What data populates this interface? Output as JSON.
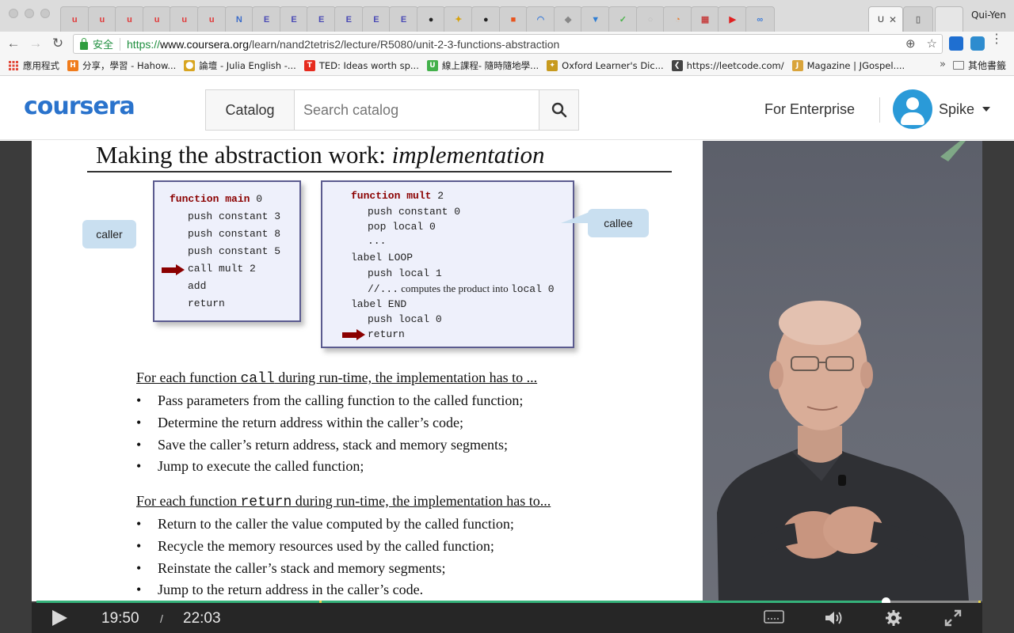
{
  "browser": {
    "profile_name": "Qui-Yen",
    "active_tab_title": "U",
    "tabs": [
      {
        "icon": "u",
        "color": "#e03a3a"
      },
      {
        "icon": "u",
        "color": "#e03a3a"
      },
      {
        "icon": "u",
        "color": "#e03a3a"
      },
      {
        "icon": "u",
        "color": "#e03a3a"
      },
      {
        "icon": "u",
        "color": "#e03a3a"
      },
      {
        "icon": "u",
        "color": "#e03a3a"
      },
      {
        "icon": "N",
        "color": "#3b6cc9"
      },
      {
        "icon": "E",
        "color": "#4b4bb5"
      },
      {
        "icon": "E",
        "color": "#4b4bb5"
      },
      {
        "icon": "E",
        "color": "#4b4bb5"
      },
      {
        "icon": "E",
        "color": "#4b4bb5"
      },
      {
        "icon": "E",
        "color": "#4b4bb5"
      },
      {
        "icon": "E",
        "color": "#4b4bb5"
      },
      {
        "icon": "●",
        "color": "#222222"
      },
      {
        "icon": "✦",
        "color": "#d7a10c"
      },
      {
        "icon": "●",
        "color": "#222222"
      },
      {
        "icon": "■",
        "color": "#e8541e"
      },
      {
        "icon": "◠",
        "color": "#3d7cd8"
      },
      {
        "icon": "◆",
        "color": "#888888"
      },
      {
        "icon": "▼",
        "color": "#2f7dd3"
      },
      {
        "icon": "✓",
        "color": "#4bb34b"
      },
      {
        "icon": "○",
        "color": "#bbbbbb"
      },
      {
        "icon": "◔",
        "color": "#e87a2c"
      },
      {
        "icon": "▦",
        "color": "#c64545"
      },
      {
        "icon": "▶",
        "color": "#e02020"
      },
      {
        "icon": "∞",
        "color": "#3d7cd8"
      }
    ],
    "url": {
      "secure_label": "安全",
      "protocol": "https://",
      "host": "www.coursera.org",
      "path": "/learn/nand2tetris2/lecture/R5080/unit-2-3-functions-abstraction"
    },
    "bookmarks": [
      {
        "label": "應用程式",
        "icon": "apps",
        "color": "#e24a3b"
      },
      {
        "label": "分享，學習 - Hahow...",
        "icon": "H",
        "color": "#f07c1c"
      },
      {
        "label": "論壇 - Julia English -...",
        "icon": "⬤",
        "color": "#d8a521"
      },
      {
        "label": "TED: Ideas worth sp...",
        "icon": "T",
        "color": "#e62b1e"
      },
      {
        "label": "線上課程- 隨時隨地學...",
        "icon": "U",
        "color": "#43b14b"
      },
      {
        "label": "Oxford Learner's Dic...",
        "icon": "✦",
        "color": "#c79a1e"
      },
      {
        "label": "https://leetcode.com/",
        "icon": "❮",
        "color": "#444444"
      },
      {
        "label": "Magazine | JGospel....",
        "icon": "J",
        "color": "#d9a43b"
      }
    ],
    "more_bookmarks": "»",
    "other_bookmarks": "其他書籤"
  },
  "header": {
    "logo": "coursera",
    "catalog_label": "Catalog",
    "search_placeholder": "Search catalog",
    "enterprise_label": "For Enterprise",
    "user_name": "Spike"
  },
  "slide": {
    "title_plain": "Making the abstraction work: ",
    "title_italic": "implementation",
    "caller_label": "caller",
    "callee_label": "callee",
    "main_code": {
      "header_kw": "function main",
      "header_arg": " 0",
      "lines": [
        "push constant 3",
        "push constant 8",
        "push constant 5",
        "call mult 2",
        "add",
        "return"
      ]
    },
    "mult_code": {
      "header_kw": "function mult",
      "header_arg": " 2",
      "lines": [
        "push constant 0",
        "pop local 0",
        "...",
        "label LOOP",
        "push local 1",
        "//...",
        "label END",
        "push local 0",
        "return"
      ],
      "comment_text": " computes the product into ",
      "comment_code": "local 0"
    },
    "call_section": {
      "prefix": "For each function ",
      "keyword": "call",
      "suffix": " during run-time, the implementation has to ...",
      "bullets": [
        "Pass parameters from the calling function to the called function;",
        "Determine the return address within the caller’s code;",
        "Save the caller’s return address, stack and memory segments;",
        "Jump to execute the called function;"
      ]
    },
    "return_section": {
      "prefix": "For each function ",
      "keyword": "return",
      "suffix": " during run-time, the implementation has to...",
      "bullets": [
        "Return to the caller the value computed by the called function;",
        "Recycle the memory resources used by the called function;",
        "Reinstate the caller’s stack and memory segments;",
        "Jump to the return address in the caller’s code."
      ]
    }
  },
  "player": {
    "current_time": "19:50",
    "separator": "/",
    "duration": "22:03",
    "progress_fraction": 0.899,
    "accent_color": "#35b27a"
  }
}
